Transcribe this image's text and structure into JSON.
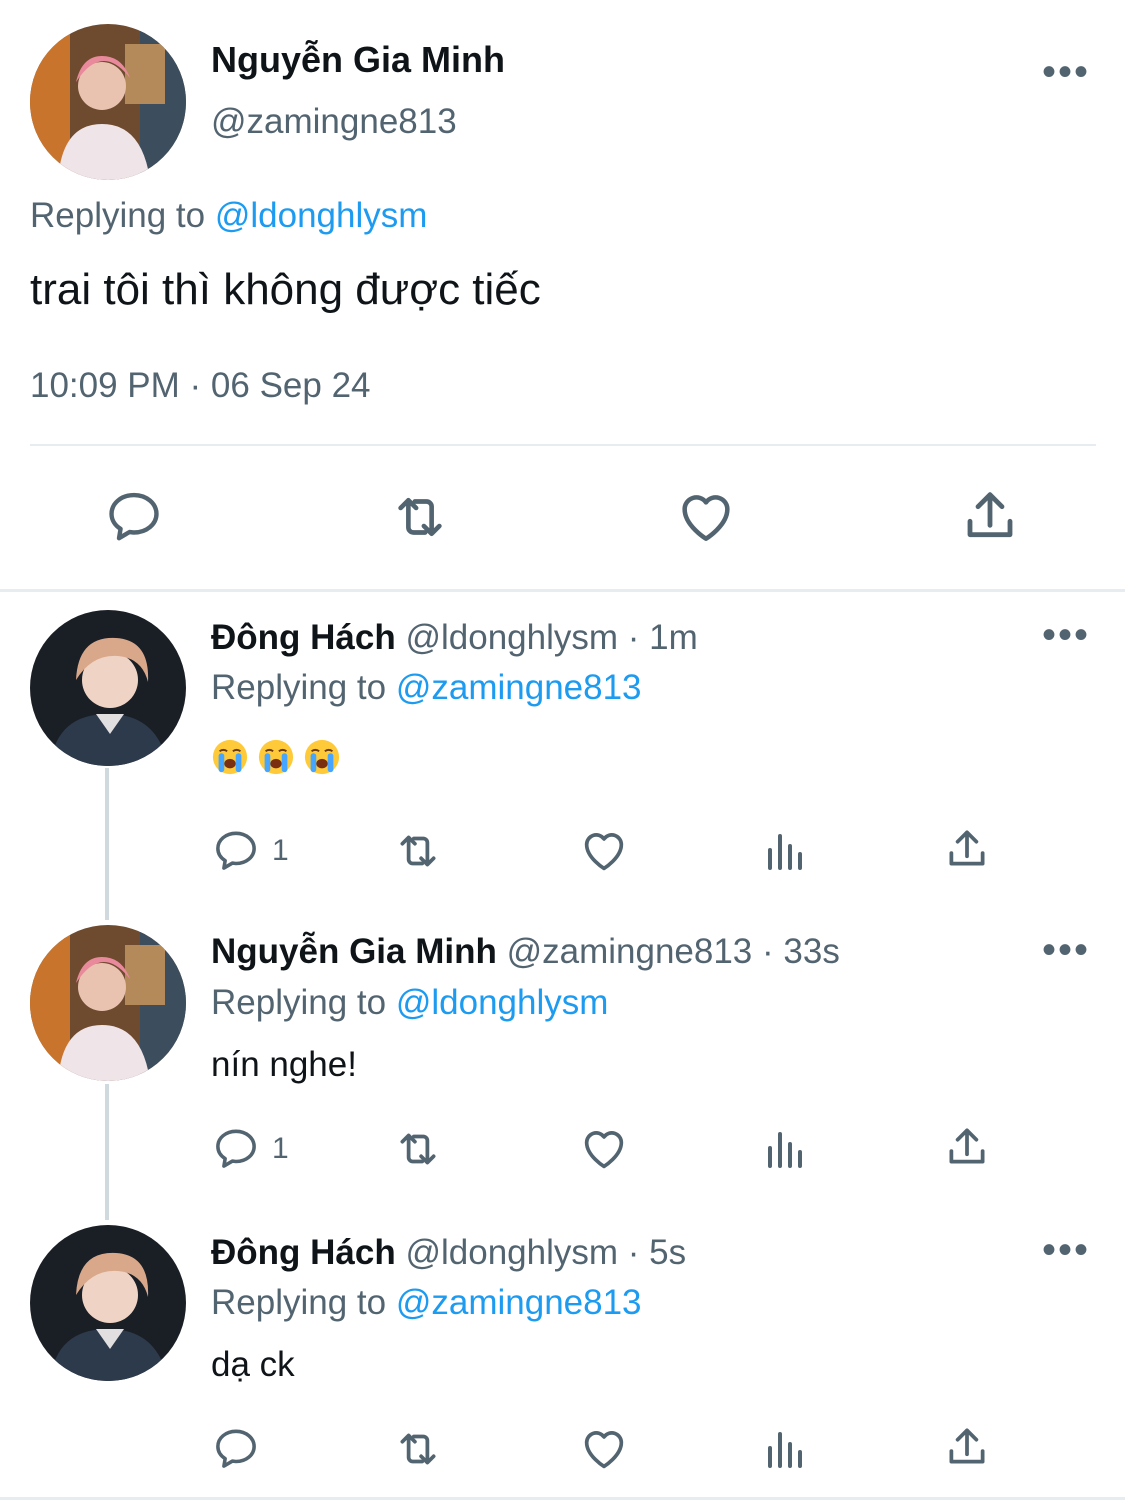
{
  "main_tweet": {
    "author_name": "Nguyễn Gia Minh",
    "author_handle": "@zamingne813",
    "replying_prefix": "Replying to",
    "replying_handle": "@ldonghlysm",
    "text": "trai tôi thì không được tiếc",
    "timestamp": "10:09 PM · 06 Sep 24",
    "actions": [
      "reply-icon",
      "retweet-icon",
      "like-icon",
      "share-icon"
    ]
  },
  "replies": [
    {
      "author_name": "Đông Hách",
      "author_handle": "@ldonghlysm",
      "time": "· 1m",
      "replying_prefix": "Replying to",
      "replying_handle": "@zamingne813",
      "text": "😭😭😭",
      "reply_count": "1"
    },
    {
      "author_name": "Nguyễn Gia Minh",
      "author_handle": "@zamingne813",
      "time": "· 33s",
      "replying_prefix": "Replying to",
      "replying_handle": "@ldonghlysm",
      "text": "nín nghe!",
      "reply_count": "1"
    },
    {
      "author_name": "Đông Hách",
      "author_handle": "@ldonghlysm",
      "time": "· 5s",
      "replying_prefix": "Replying to",
      "replying_handle": "@zamingne813",
      "text": "dạ ck",
      "reply_count": ""
    }
  ],
  "colors": {
    "accent": "#1d9bf0",
    "secondary_text": "#536471",
    "primary_text": "#0f1419",
    "divider": "#e6ecf0",
    "thread_line": "#cfd9de"
  }
}
